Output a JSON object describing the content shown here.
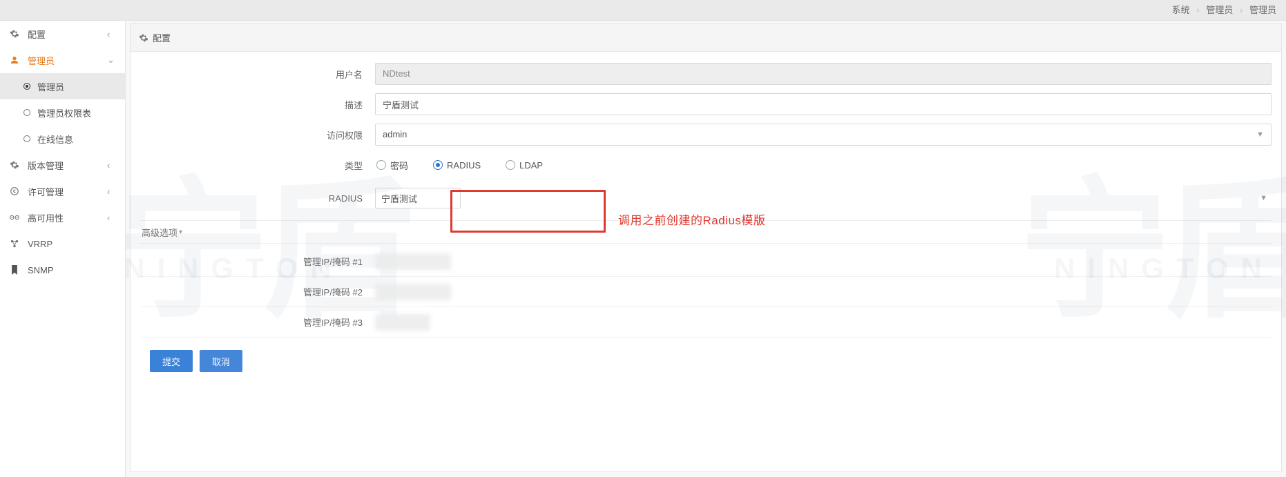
{
  "breadcrumb": {
    "items": [
      "系统",
      "管理员",
      "管理员"
    ]
  },
  "sidebar": {
    "items": [
      {
        "icon": "gear-icon",
        "label": "配置",
        "chev": "left",
        "kind": "top"
      },
      {
        "icon": "user-icon",
        "label": "管理员",
        "chev": "down",
        "kind": "top-expanded",
        "children": [
          {
            "label": "管理员",
            "active": true
          },
          {
            "label": "管理员权限表",
            "active": false
          },
          {
            "label": "在线信息",
            "active": false
          }
        ]
      },
      {
        "icon": "gear-icon",
        "label": "版本管理",
        "chev": "left",
        "kind": "top"
      },
      {
        "icon": "copyright-icon",
        "label": "许可管理",
        "chev": "left",
        "kind": "top"
      },
      {
        "icon": "eyes-icon",
        "label": "高可用性",
        "chev": "left",
        "kind": "top"
      },
      {
        "icon": "nodes-icon",
        "label": "VRRP",
        "chev": "",
        "kind": "top"
      },
      {
        "icon": "bookmark-icon",
        "label": "SNMP",
        "chev": "",
        "kind": "top"
      }
    ]
  },
  "panel": {
    "title": "配置"
  },
  "form": {
    "username_label": "用户名",
    "username_value": "NDtest",
    "desc_label": "描述",
    "desc_value": "宁盾测试",
    "access_label": "访问权限",
    "access_value": "admin",
    "type_label": "类型",
    "type_options": {
      "pwd": "密码",
      "radius": "RADIUS",
      "ldap": "LDAP"
    },
    "type_selected": "radius",
    "radius_label": "RADIUS",
    "radius_value": "宁盾测试",
    "adv_label": "高级选项",
    "ip_labels": [
      "管理IP/掩码 #1",
      "管理IP/掩码 #2",
      "管理IP/掩码 #3"
    ]
  },
  "annotation": "调用之前创建的Radius模版",
  "actions": {
    "submit": "提交",
    "cancel": "取消"
  },
  "watermark": {
    "logo": "宁盾",
    "text": "NINGTON"
  }
}
